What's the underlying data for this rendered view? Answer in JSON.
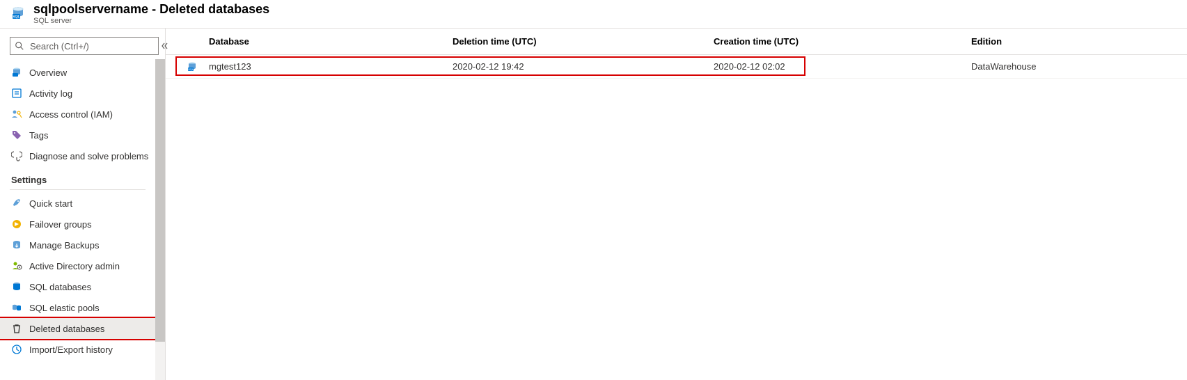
{
  "header": {
    "title": "sqlpoolservername - Deleted databases",
    "subtitle": "SQL server"
  },
  "search": {
    "placeholder": "Search (Ctrl+/)"
  },
  "sidebar": {
    "top_items": [
      {
        "label": "Overview"
      },
      {
        "label": "Activity log"
      },
      {
        "label": "Access control (IAM)"
      },
      {
        "label": "Tags"
      },
      {
        "label": "Diagnose and solve problems"
      }
    ],
    "settings_label": "Settings",
    "settings_items": [
      {
        "label": "Quick start"
      },
      {
        "label": "Failover groups"
      },
      {
        "label": "Manage Backups"
      },
      {
        "label": "Active Directory admin"
      },
      {
        "label": "SQL databases"
      },
      {
        "label": "SQL elastic pools"
      },
      {
        "label": "Deleted databases"
      },
      {
        "label": "Import/Export history"
      }
    ]
  },
  "table": {
    "columns": {
      "database": "Database",
      "deletion_time": "Deletion time (UTC)",
      "creation_time": "Creation time (UTC)",
      "edition": "Edition"
    },
    "rows": [
      {
        "database": "mgtest123",
        "deletion_time": "2020-02-12 19:42",
        "creation_time": "2020-02-12 02:02",
        "edition": "DataWarehouse"
      }
    ]
  }
}
